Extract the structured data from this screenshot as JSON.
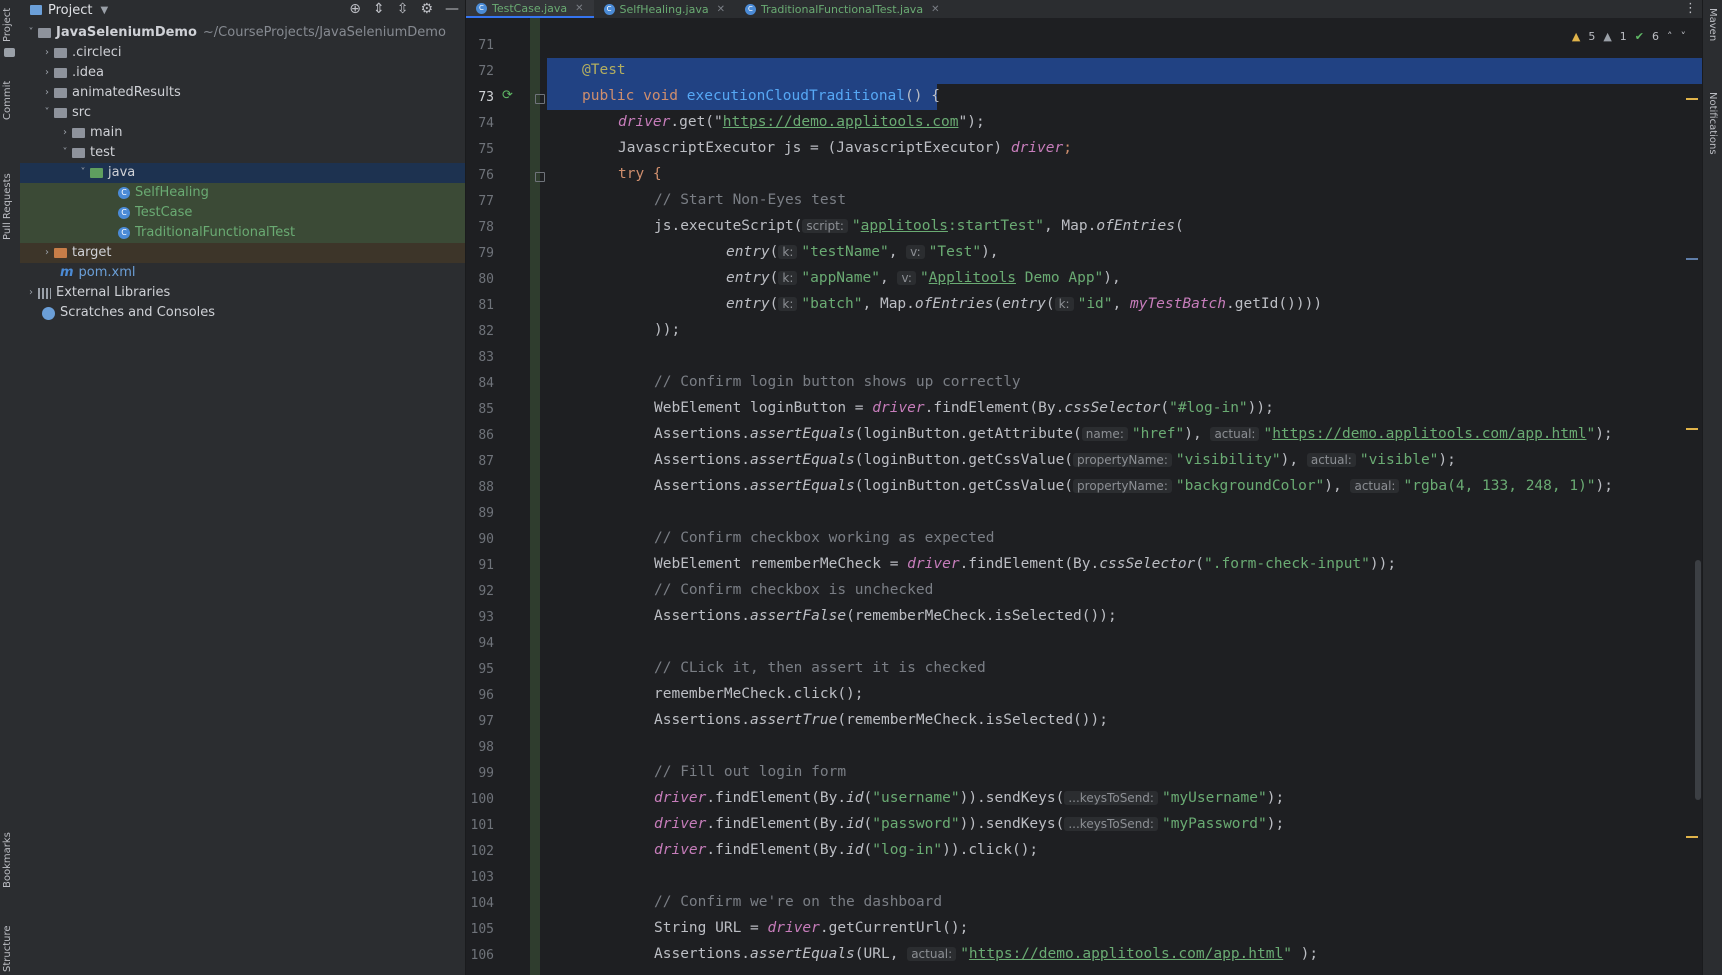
{
  "left_toolstrip": [
    "Project",
    "Commit",
    "Pull Requests",
    "Bookmarks",
    "Structure"
  ],
  "right_toolstrip": [
    "Maven",
    "Notifications"
  ],
  "project_panel": {
    "title": "Project",
    "root": {
      "name": "JavaSeleniumDemo",
      "path": "~/CourseProjects/JavaSeleniumDemo"
    },
    "items": [
      {
        "label": ".circleci"
      },
      {
        "label": ".idea"
      },
      {
        "label": "animatedResults"
      },
      {
        "label": "src"
      },
      {
        "label": "main"
      },
      {
        "label": "test"
      },
      {
        "label": "java"
      },
      {
        "label": "SelfHealing"
      },
      {
        "label": "TestCase"
      },
      {
        "label": "TraditionalFunctionalTest"
      },
      {
        "label": "target"
      },
      {
        "label": "pom.xml"
      },
      {
        "label": "External Libraries"
      },
      {
        "label": "Scratches and Consoles"
      }
    ]
  },
  "editor_tabs": [
    {
      "label": "TestCase.java",
      "active": true
    },
    {
      "label": "SelfHealing.java",
      "active": false
    },
    {
      "label": "TraditionalFunctionalTest.java",
      "active": false
    }
  ],
  "inspections": {
    "warnings": "5",
    "weak_warnings": "1",
    "ok": "6"
  },
  "line_numbers": [
    "71",
    "72",
    "73",
    "74",
    "75",
    "76",
    "77",
    "78",
    "79",
    "80",
    "81",
    "82",
    "83",
    "84",
    "85",
    "86",
    "87",
    "88",
    "89",
    "90",
    "91",
    "92",
    "93",
    "94",
    "95",
    "96",
    "97",
    "98",
    "99",
    "100",
    "101",
    "102",
    "103",
    "104",
    "105",
    "106"
  ],
  "code": {
    "l72": "@Test",
    "l73_kw": "public void ",
    "l73_fn": "executionCloudTraditional",
    "l73_rest": "() {",
    "l74_a": "driver",
    "l74_b": ".get(\"",
    "l74_url": "https://demo.applitools.com",
    "l74_c": "\");",
    "l75_a": "JavascriptExecutor js = (JavascriptExecutor) ",
    "l75_b": "driver",
    "l75_c": ";",
    "l76": "try {",
    "l77": "// Start Non-Eyes test",
    "l78_a": "js.executeScript(",
    "l78_hint": "script:",
    "l78_str1": "\"",
    "l78_u": "applitools",
    "l78_str2": ":startTest\"",
    "l78_c": ", Map.",
    "l78_it": "ofEntries",
    "l78_d": "(",
    "l79_it": "entry",
    "l79_a": "(",
    "l79_hk": "k:",
    "l79_s1": "\"testName\"",
    "l79_b": ", ",
    "l79_hv": "v:",
    "l79_s2": "\"Test\"",
    "l79_c": "),",
    "l80_it": "entry",
    "l80_a": "(",
    "l80_hk": "k:",
    "l80_s1": "\"appName\"",
    "l80_b": ", ",
    "l80_hv": "v:",
    "l80_s2a": "\"",
    "l80_u": "Applitools",
    "l80_s2b": " Demo App\"",
    "l80_c": "),",
    "l81_it": "entry",
    "l81_a": "(",
    "l81_hk": "k:",
    "l81_s1": "\"batch\"",
    "l81_b": ", Map.",
    "l81_it2": "ofEntries",
    "l81_c": "(",
    "l81_it3": "entry",
    "l81_d": "(",
    "l81_hk2": "k:",
    "l81_s2": "\"id\"",
    "l81_e": ", ",
    "l81_f": "myTestBatch",
    "l81_g": ".getId())))",
    "l82": "));",
    "l84": "// Confirm login button shows up correctly",
    "l85_a": "WebElement loginButton = ",
    "l85_b": "driver",
    "l85_c": ".findElement(By.",
    "l85_it": "cssSelector",
    "l85_d": "(",
    "l85_s": "\"#log-in\"",
    "l85_e": "));",
    "l86_a": "Assertions.",
    "l86_it": "assertEquals",
    "l86_b": "(loginButton.getAttribute(",
    "l86_h1": "name:",
    "l86_s1": "\"href\"",
    "l86_c": "), ",
    "l86_h2": "actual:",
    "l86_q1": "\"",
    "l86_url": "https://demo.applitools.com/app.html",
    "l86_q2": "\"",
    "l86_d": ");",
    "l87_a": "Assertions.",
    "l87_it": "assertEquals",
    "l87_b": "(loginButton.getCssValue(",
    "l87_h1": "propertyName:",
    "l87_s1": "\"visibility\"",
    "l87_c": "), ",
    "l87_h2": "actual:",
    "l87_s2": "\"visible\"",
    "l87_d": ");",
    "l88_a": "Assertions.",
    "l88_it": "assertEquals",
    "l88_b": "(loginButton.getCssValue(",
    "l88_h1": "propertyName:",
    "l88_s1": "\"backgroundColor\"",
    "l88_c": "), ",
    "l88_h2": "actual:",
    "l88_s2": "\"rgba(4, 133, 248, 1)\"",
    "l88_d": ");",
    "l90": "// Confirm checkbox working as expected",
    "l91_a": "WebElement rememberMeCheck = ",
    "l91_b": "driver",
    "l91_c": ".findElement(By.",
    "l91_it": "cssSelector",
    "l91_d": "(",
    "l91_s": "\".form-check-input\"",
    "l91_e": "));",
    "l92": "// Confirm checkbox is unchecked",
    "l93_a": "Assertions.",
    "l93_it": "assertFalse",
    "l93_b": "(rememberMeCheck.isSelected());",
    "l95": "// CLick it, then assert it is checked",
    "l96": "rememberMeCheck.click();",
    "l97_a": "Assertions.",
    "l97_it": "assertTrue",
    "l97_b": "(rememberMeCheck.isSelected());",
    "l99": "// Fill out login form",
    "l100_a": "driver",
    "l100_b": ".findElement(By.",
    "l100_it": "id",
    "l100_c": "(",
    "l100_s1": "\"username\"",
    "l100_d": ")).sendKeys(",
    "l100_h": "...keysToSend:",
    "l100_s2": "\"myUsername\"",
    "l100_e": ");",
    "l101_a": "driver",
    "l101_b": ".findElement(By.",
    "l101_it": "id",
    "l101_c": "(",
    "l101_s1": "\"password\"",
    "l101_d": ")).sendKeys(",
    "l101_h": "...keysToSend:",
    "l101_s2": "\"myPassword\"",
    "l101_e": ");",
    "l102_a": "driver",
    "l102_b": ".findElement(By.",
    "l102_it": "id",
    "l102_c": "(",
    "l102_s1": "\"log-in\"",
    "l102_d": ")).click();",
    "l104": "// Confirm we're on the dashboard",
    "l105_a": "String URL = ",
    "l105_b": "driver",
    "l105_c": ".getCurrentUrl();",
    "l106_a": "Assertions.",
    "l106_it": "assertEquals",
    "l106_b": "(URL, ",
    "l106_h": "actual:",
    "l106_q1": "\"",
    "l106_url": "https://demo.applitools.com/app.html",
    "l106_q2": "\"",
    "l106_c": " );"
  }
}
